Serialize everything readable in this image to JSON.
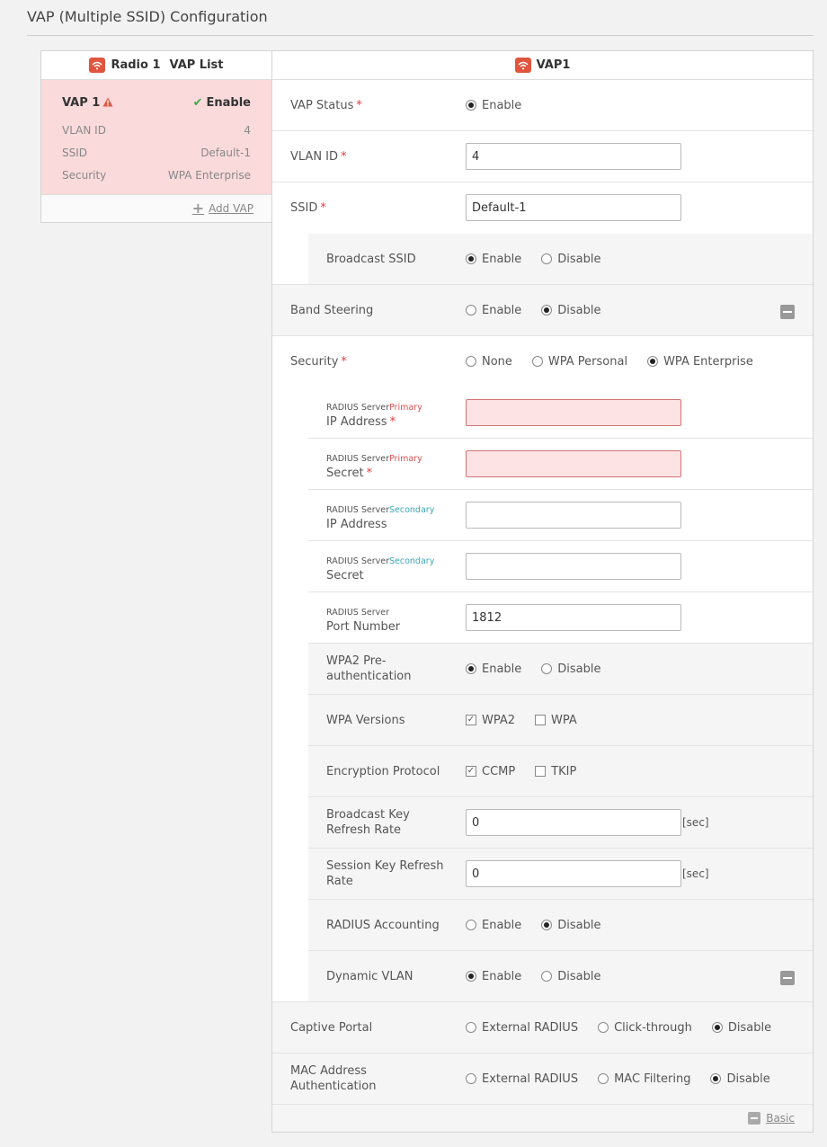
{
  "page": {
    "title": "VAP (Multiple SSID) Configuration"
  },
  "colors": {
    "accent": "#e0553d",
    "error_bg": "#fde3e3",
    "card_bg": "#fadadb",
    "ok": "#3ea84a"
  },
  "left_panel": {
    "radio": "Radio 1",
    "header": "VAP List",
    "vap": {
      "name": "VAP 1",
      "status": "Enable",
      "rows": [
        {
          "label": "VLAN ID",
          "value": "4"
        },
        {
          "label": "SSID",
          "value": "Default-1"
        },
        {
          "label": "Security",
          "value": "WPA Enterprise"
        }
      ]
    },
    "add_label": "Add VAP"
  },
  "right_panel": {
    "header": "VAP1",
    "vap_status": {
      "label": "VAP Status",
      "options": [
        "Enable"
      ]
    },
    "vlan_id": {
      "label": "VLAN ID",
      "value": "4"
    },
    "ssid": {
      "label": "SSID",
      "value": "Default-1"
    },
    "broadcast_ssid": {
      "label": "Broadcast SSID",
      "options": [
        "Enable",
        "Disable"
      ]
    },
    "band_steering": {
      "label": "Band Steering",
      "options": [
        "Enable",
        "Disable"
      ]
    },
    "security": {
      "label": "Security",
      "options": [
        "None",
        "WPA Personal",
        "WPA Enterprise"
      ]
    },
    "radius_server": "RADIUS Server",
    "primary": "Primary",
    "secondary": "Secondary",
    "ip_address": "IP Address",
    "secret": "Secret",
    "port_number": {
      "label": "Port Number",
      "value": "1812"
    },
    "wpa2_preauth": {
      "label": "WPA2 Pre-authentication",
      "options": [
        "Enable",
        "Disable"
      ]
    },
    "wpa_versions": {
      "label": "WPA Versions",
      "options": [
        "WPA2",
        "WPA"
      ]
    },
    "encryption": {
      "label": "Encryption Protocol",
      "options": [
        "CCMP",
        "TKIP"
      ]
    },
    "bcast_key": {
      "label": "Broadcast Key Refresh Rate",
      "value": "0",
      "unit": "[sec]"
    },
    "session_key": {
      "label": "Session Key Refresh Rate",
      "value": "0",
      "unit": "[sec]"
    },
    "radius_accounting": {
      "label": "RADIUS Accounting",
      "options": [
        "Enable",
        "Disable"
      ]
    },
    "dynamic_vlan": {
      "label": "Dynamic VLAN",
      "options": [
        "Enable",
        "Disable"
      ]
    },
    "captive_portal": {
      "label": "Captive Portal",
      "options": [
        "External RADIUS",
        "Click-through",
        "Disable"
      ]
    },
    "mac_auth": {
      "label": "MAC Address Authentication",
      "options": [
        "External RADIUS",
        "MAC Filtering",
        "Disable"
      ]
    },
    "basic_label": "Basic"
  }
}
